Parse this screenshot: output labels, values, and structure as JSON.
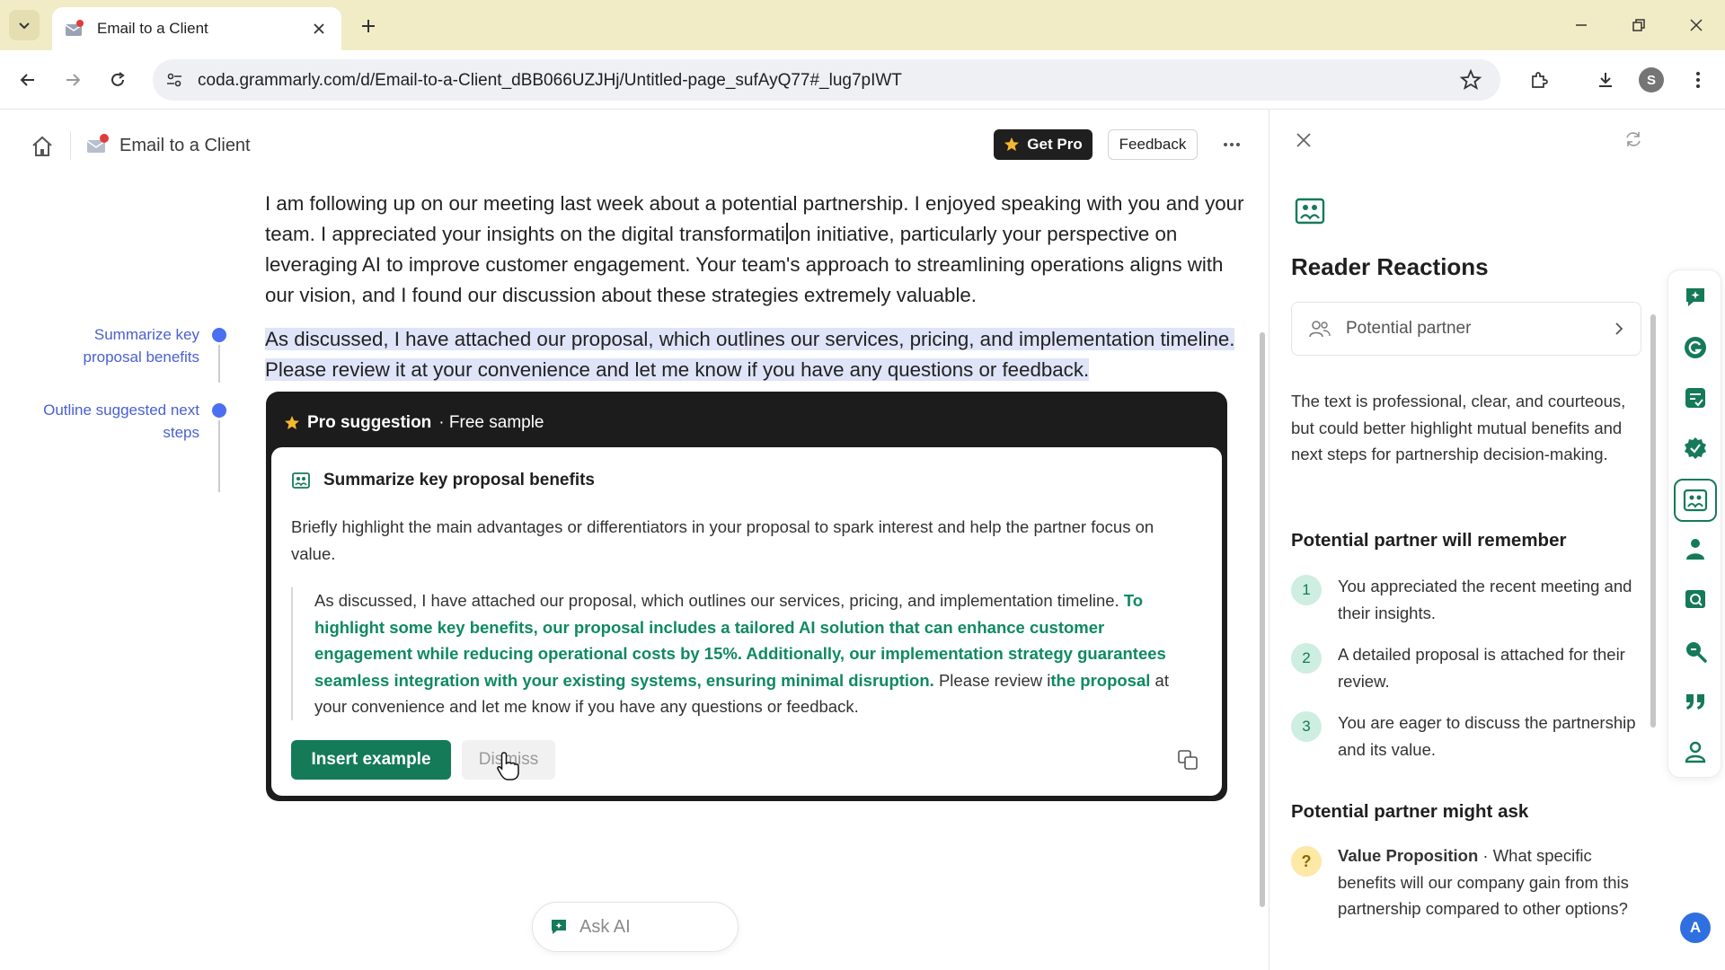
{
  "browser": {
    "tab_title": "Email to a Client",
    "url": "coda.grammarly.com/d/Email-to-a-Client_dBB066UZJHj/Untitled-page_sufAyQ77#_lug7pIWT",
    "profile_initial": "S"
  },
  "header": {
    "doc_title": "Email to a Client",
    "get_pro_label": "Get Pro",
    "feedback_label": "Feedback"
  },
  "document": {
    "para1_a": "I am following up on our meeting last week about a potential partnership. I enjoyed speaking with you and your team. I appreciated your insights on the digital transformati",
    "para1_b": "on initiative, particularly your perspective on leveraging AI to improve customer engagement. Your team's approach to streamlining operations aligns with our vision, and I found our discussion about these strategies extremely valuable.",
    "para2": "As discussed, I have attached our proposal, which outlines our services, pricing, and implementation timeline. Please review it at your convenience and let me know if you have any questions or feedback."
  },
  "outline": {
    "items": [
      "Summarize key proposal benefits",
      "Outline suggested next steps"
    ]
  },
  "suggestion": {
    "header_bold": "Pro suggestion",
    "header_rest": "· Free sample",
    "title": "Summarize key proposal benefits",
    "description": "Briefly highlight the main advantages or differentiators in your proposal to spark interest and help the partner focus on value.",
    "quote_start": "As discussed, I have attached our proposal, which outlines our services, pricing, and implementation timeline. ",
    "quote_insert": "To highlight some key benefits, our proposal includes a tailored AI solution that can enhance customer engagement while reducing operational costs by 15%. Additionally, our implementation strategy guarantees seamless integration with your existing systems, ensuring minimal disruption.",
    "quote_mid": " Please review i",
    "quote_insert2": "the proposal",
    "quote_end": " at your convenience and let me know if you have any questions or feedback.",
    "insert_label": "Insert example",
    "dismiss_label": "Dismiss"
  },
  "ask_ai": {
    "label": "Ask AI"
  },
  "panel": {
    "title": "Reader Reactions",
    "persona": "Potential partner",
    "summary": "The text is professional, clear, and courteous, but could better highlight mutual benefits and next steps for partnership decision-making.",
    "remember_heading": "Potential partner will remember",
    "remember_items": [
      {
        "num": "1",
        "text": "You appreciated the recent meeting and their insights."
      },
      {
        "num": "2",
        "text": "A detailed proposal is attached for their review."
      },
      {
        "num": "3",
        "text": "You are eager to discuss the partnership and its value."
      }
    ],
    "ask_heading": "Potential partner might ask",
    "ask_item": {
      "mark": "?",
      "bold": "Value Proposition",
      "text": " · What specific benefits will our company gain from this partnership compared to other options?"
    }
  },
  "account_initial": "A",
  "colors": {
    "accent_green": "#157a57",
    "outline_blue": "#4a6ff0",
    "selection": "#dfe4f8",
    "tabbar": "#f1ecc5"
  }
}
